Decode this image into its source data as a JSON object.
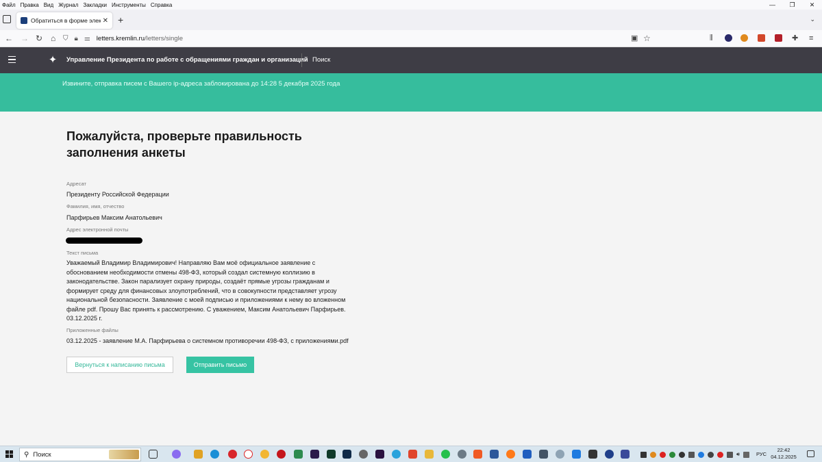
{
  "menubar": {
    "items": [
      {
        "label": "Файл"
      },
      {
        "label": "Правка"
      },
      {
        "label": "Вид"
      },
      {
        "label": "Журнал"
      },
      {
        "label": "Закладки"
      },
      {
        "label": "Инструменты"
      },
      {
        "label": "Справка"
      }
    ]
  },
  "window_controls": {
    "minimize": "—",
    "restore": "❐",
    "close": "✕"
  },
  "browser": {
    "tab_title": "Обратиться в форме электрон",
    "url_host": "letters.kremlin.ru",
    "url_path": "/letters/single"
  },
  "site": {
    "title": "Управление Президента по работе с обращениями граждан и организаций",
    "search_label": "Поиск"
  },
  "notice": {
    "text": "Извините, отправка писем с Вашего ip-адреса заблокирована до 14:28 5 декабря 2025 года",
    "color": "#36bd9d"
  },
  "form_review": {
    "title": "Пожалуйста, проверьте правильность заполнения анкеты",
    "addressee_label": "Адресат",
    "addressee_value": "Президенту Российской Федерации",
    "name_label": "Фамилия, имя, отчество",
    "name_value": "Парфирьев Максим Анатольевич",
    "email_label": "Адрес электронной почты",
    "letter_label": "Текст письма",
    "letter_text": "Уважаемый Владимир Владимирович! Направляю Вам моё официальное заявление с обоснованием необходимости отмены 498-ФЗ, который создал системную коллизию в законодательстве. Закон парализует охрану природы, создаёт прямые угрозы гражданам и формирует среду для финансовых злоупотреблений, что в совокупности представляет угрозу национальной безопасности. Заявление с моей подписью и приложениями к нему во вложенном файле pdf. Прошу Вас принять к рассмотрению. С уважением, Максим Анатольевич Парфирьев. 03.12.2025 г.",
    "attachments_label": "Приложенные файлы",
    "attachment_name": "03.12.2025 - заявление М.А. Парфирьева о системном противоречии 498-ФЗ, с приложениями.pdf",
    "back_button": "Вернуться к написанию письма",
    "send_button": "Отправить письмо"
  },
  "taskbar": {
    "search_label": "Поиск",
    "lang": "РУС",
    "time": "22:42",
    "date": "04.12.2025"
  }
}
